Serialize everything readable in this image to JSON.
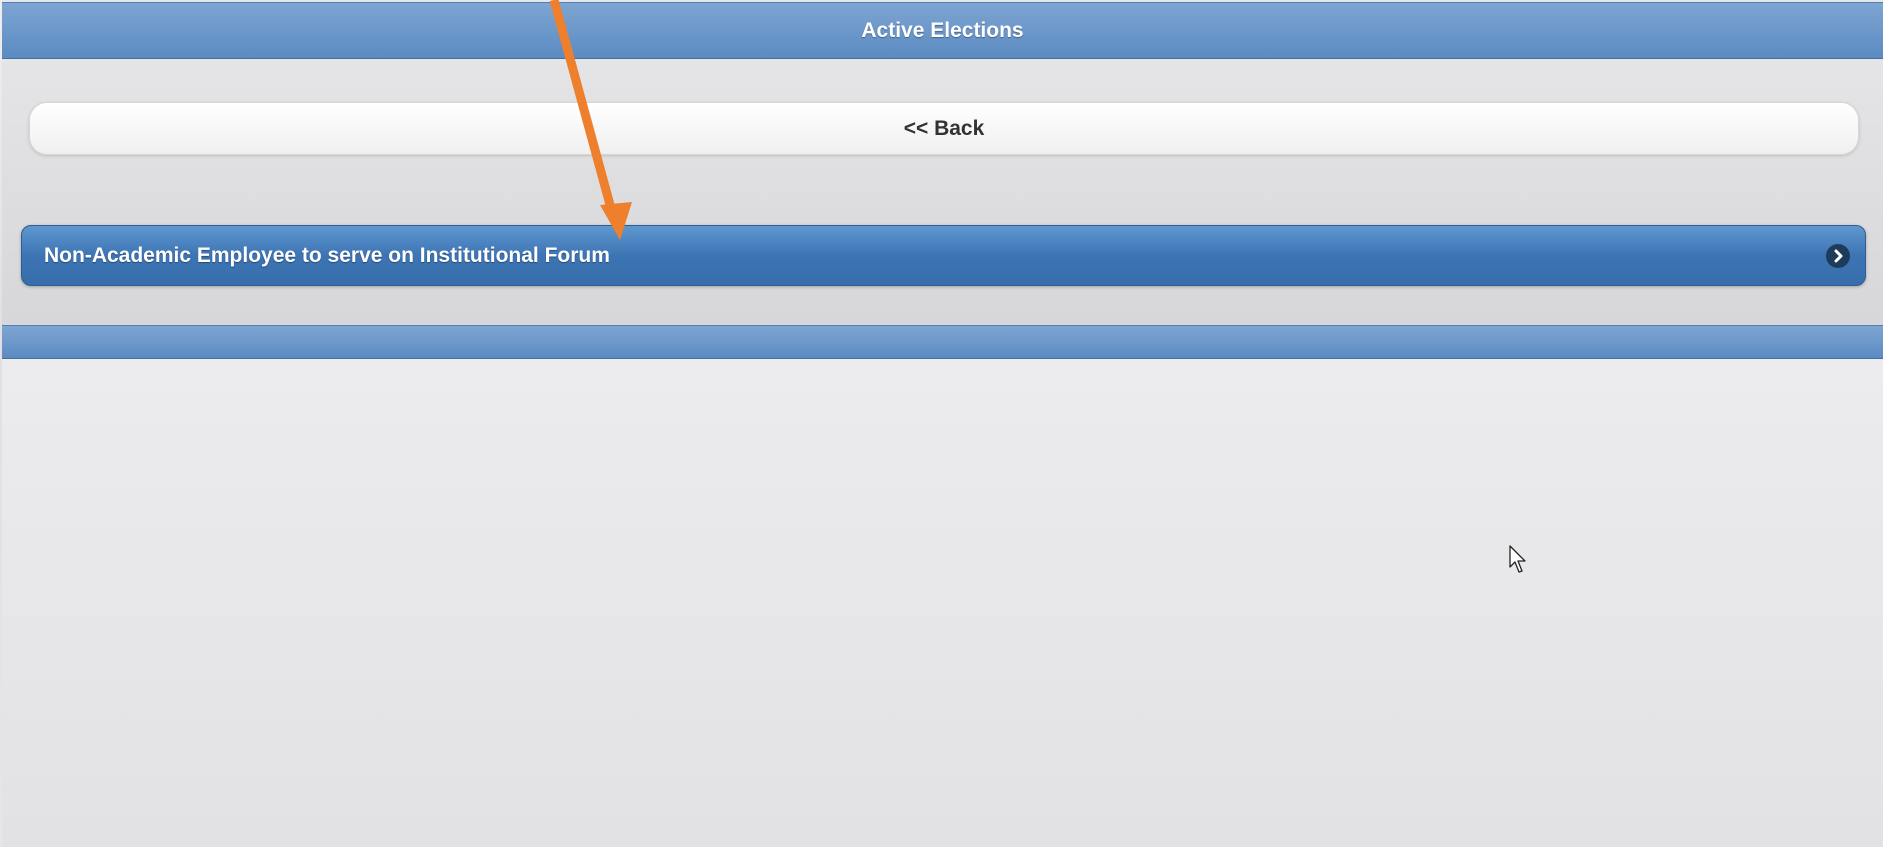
{
  "header": {
    "title": "Active Elections"
  },
  "toolbar": {
    "back_label": "<< Back"
  },
  "elections": [
    {
      "label": "Non-Academic Employee to serve on Institutional Forum",
      "icon": "chevron-right-icon"
    }
  ],
  "colors": {
    "header_blue": "#5b8bc2",
    "list_item_blue": "#3d74b4",
    "annotation_orange": "#ee7f2d"
  }
}
